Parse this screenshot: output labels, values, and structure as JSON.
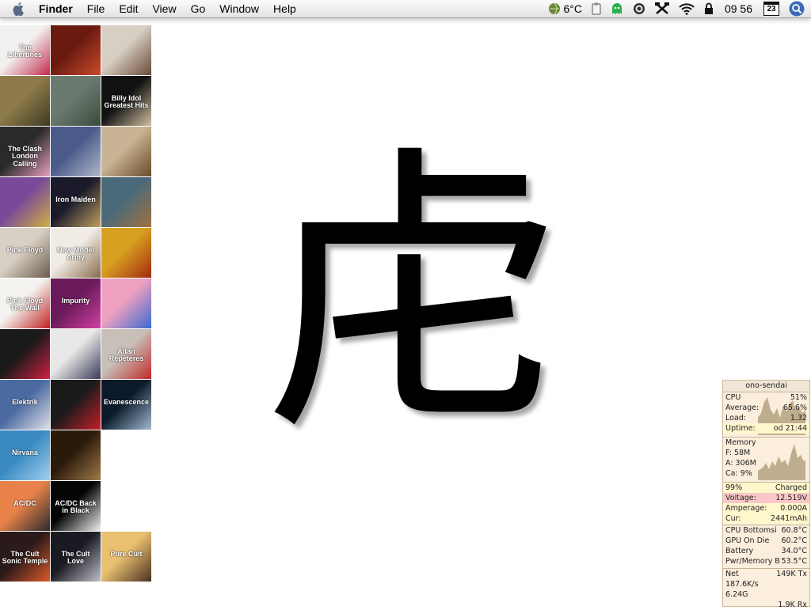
{
  "menubar": {
    "app_name": "Finder",
    "menus": [
      "File",
      "Edit",
      "View",
      "Go",
      "Window",
      "Help"
    ],
    "temperature": "6°C",
    "clock": "09 56",
    "calendar_day": "23",
    "icons": [
      "apple-icon",
      "weather-icon",
      "clipboard-icon",
      "ghost-icon",
      "settings-icon",
      "tools-icon",
      "wifi-icon",
      "lock-icon",
      "calendar-icon",
      "spotlight-icon"
    ]
  },
  "albums": [
    {
      "title": "The Libertines",
      "colors": [
        "#f2f0ee",
        "#c22a4a"
      ]
    },
    {
      "title": "",
      "colors": [
        "#6b1a10",
        "#c84a2a"
      ]
    },
    {
      "title": "",
      "colors": [
        "#d7cfc4",
        "#6a4a36"
      ]
    },
    {
      "title": "",
      "colors": [
        "#8c7a4a",
        "#3e3a22"
      ]
    },
    {
      "title": "",
      "colors": [
        "#6a7a70",
        "#3a4a3a"
      ]
    },
    {
      "title": "Billy Idol Greatest Hits",
      "colors": [
        "#111111",
        "#d0c0a0"
      ]
    },
    {
      "title": "The Clash London Calling",
      "colors": [
        "#2a2a2a",
        "#e8a0c0"
      ]
    },
    {
      "title": "",
      "colors": [
        "#4a5a8a",
        "#b0b8c8"
      ]
    },
    {
      "title": "",
      "colors": [
        "#c8b494",
        "#6a4a2a"
      ]
    },
    {
      "title": "",
      "colors": [
        "#7a4a9a",
        "#d0b040"
      ]
    },
    {
      "title": "Iron Maiden",
      "colors": [
        "#1a1a2a",
        "#c0a060"
      ]
    },
    {
      "title": "",
      "colors": [
        "#4a6a7a",
        "#a07040"
      ]
    },
    {
      "title": "Pink Floyd",
      "colors": [
        "#d8d0c4",
        "#6a5a4a"
      ]
    },
    {
      "title": "New Model Army",
      "colors": [
        "#f0ece4",
        "#8a6a4a"
      ]
    },
    {
      "title": "",
      "colors": [
        "#d8a020",
        "#a02a10"
      ]
    },
    {
      "title": "Pink Floyd The Wall",
      "colors": [
        "#f4f2ee",
        "#c02020"
      ]
    },
    {
      "title": "Impurity",
      "colors": [
        "#6a1a5a",
        "#d040a0"
      ]
    },
    {
      "title": "",
      "colors": [
        "#f0a0c0",
        "#3a6ad0"
      ]
    },
    {
      "title": "",
      "colors": [
        "#1a1a1a",
        "#d02040"
      ]
    },
    {
      "title": "",
      "colors": [
        "#e8e8e8",
        "#3a3a5a"
      ]
    },
    {
      "title": "Altan Repeteres",
      "colors": [
        "#c8c0b8",
        "#c02a2a"
      ]
    },
    {
      "title": "Elektrik",
      "colors": [
        "#4a6aa0",
        "#e0e0e8"
      ]
    },
    {
      "title": "",
      "colors": [
        "#1a1a1a",
        "#c0202a"
      ]
    },
    {
      "title": "Evanescence",
      "colors": [
        "#0a1a2a",
        "#a0b8d0"
      ]
    },
    {
      "title": "Nirvana",
      "colors": [
        "#3a8ac0",
        "#a0d0f0"
      ]
    },
    {
      "title": "",
      "colors": [
        "#2a1a0a",
        "#a07a4a"
      ]
    },
    null,
    {
      "title": "AC/DC",
      "colors": [
        "#e8824a",
        "#2a2a2a"
      ]
    },
    {
      "title": "AC/DC Back in Black",
      "colors": [
        "#050505",
        "#f0f0f0"
      ]
    },
    null,
    {
      "title": "The Cult Sonic Temple",
      "colors": [
        "#2a1a1a",
        "#e05a2a"
      ]
    },
    {
      "title": "The Cult Love",
      "colors": [
        "#1a1a22",
        "#c0c0c8"
      ]
    },
    {
      "title": "Pure Cult",
      "colors": [
        "#e8c070",
        "#4a3020"
      ]
    }
  ],
  "kanji": "虍",
  "monitor": {
    "host": "ono-sendai",
    "cpu": {
      "label": "CPU",
      "value": "51%",
      "average_label": "Average:",
      "average": "65.6%",
      "load_label": "Load:",
      "load": "1.32",
      "uptime_label": "Uptime:",
      "uptime": "od 21:44"
    },
    "memory": {
      "label": "Memory",
      "free": "F: 58M",
      "active": "A: 306M",
      "cache": "Ca: 9%"
    },
    "battery": {
      "percent": "99%",
      "status": "Charged",
      "voltage_label": "Voltage:",
      "voltage": "12.519V",
      "amperage_label": "Amperage:",
      "amperage": "0.000A",
      "cur_label": "Cur:",
      "cur": "2441mAh"
    },
    "temps": [
      {
        "label": "CPU Bottomsi",
        "value": "60.8°C"
      },
      {
        "label": "GPU On Die",
        "value": "60.2°C"
      },
      {
        "label": "Battery",
        "value": "34.0°C"
      },
      {
        "label": "Pwr/Memory B",
        "value": "53.5°C"
      }
    ],
    "net": {
      "label": "Net",
      "tx": "149K Tx",
      "rate": "187.6K/s",
      "total": "6.24G",
      "rx": "1.9K Rx"
    },
    "colors": {
      "background": "#fbeedd",
      "highlight": "#fbc8c8",
      "graph": "#bfae8e"
    }
  }
}
